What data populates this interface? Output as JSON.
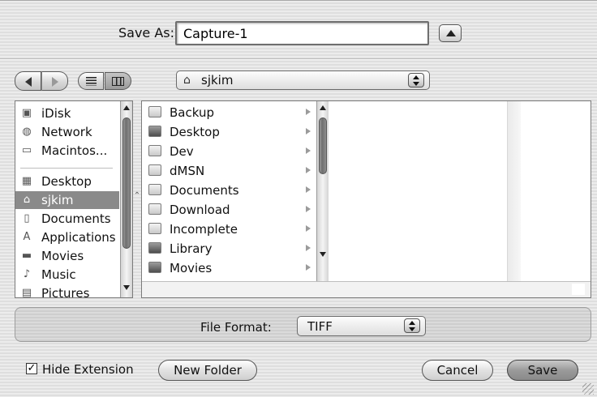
{
  "header": {
    "save_as_label": "Save As:",
    "filename_value": "Capture-1"
  },
  "toolbar": {
    "location": "sjkim"
  },
  "sidebar": {
    "items": [
      {
        "label": "iDisk",
        "icon": "disk-icon"
      },
      {
        "label": "Network",
        "icon": "globe-icon"
      },
      {
        "label": "Macintos...",
        "icon": "computer-icon"
      },
      {
        "label": "Desktop",
        "icon": "desktop-icon"
      },
      {
        "label": "sjkim",
        "icon": "home-icon",
        "selected": true
      },
      {
        "label": "Documents",
        "icon": "document-icon"
      },
      {
        "label": "Applications",
        "icon": "applications-icon"
      },
      {
        "label": "Movies",
        "icon": "movies-icon"
      },
      {
        "label": "Music",
        "icon": "music-icon"
      },
      {
        "label": "Pictures",
        "icon": "pictures-icon"
      }
    ]
  },
  "browser": {
    "column1": [
      {
        "label": "Backup"
      },
      {
        "label": "Desktop"
      },
      {
        "label": "Dev"
      },
      {
        "label": "dMSN"
      },
      {
        "label": "Documents"
      },
      {
        "label": "Download"
      },
      {
        "label": "Incomplete"
      },
      {
        "label": "Library"
      },
      {
        "label": "Movies"
      }
    ]
  },
  "format": {
    "label": "File Format:",
    "value": "TIFF"
  },
  "footer": {
    "hide_extension_label": "Hide Extension",
    "hide_extension_checked": true,
    "new_folder_label": "New Folder",
    "cancel_label": "Cancel",
    "save_label": "Save"
  }
}
